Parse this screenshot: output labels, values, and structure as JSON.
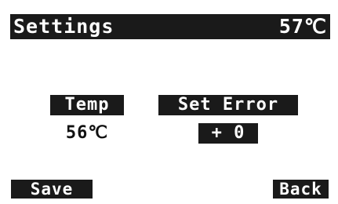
{
  "header": {
    "title": "Settings",
    "current_temp": "57℃"
  },
  "temp": {
    "label": "Temp",
    "value": "56℃"
  },
  "set_error": {
    "label": "Set Error",
    "value": "+ 0"
  },
  "softkeys": {
    "left": "Save",
    "right": "Back"
  },
  "colors": {
    "background": "#ffffff",
    "inverse_fill": "#1a1a1a",
    "inverse_text": "#ffffff",
    "text": "#111111"
  }
}
